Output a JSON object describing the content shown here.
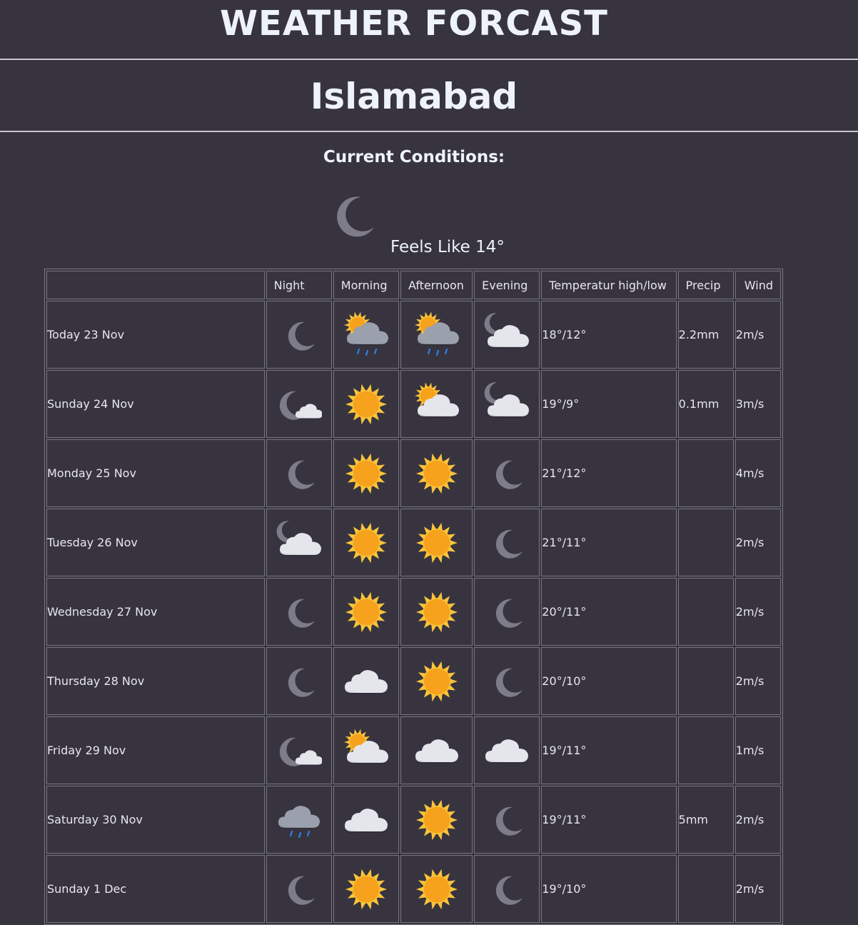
{
  "app": {
    "title": "WEATHER FORCAST"
  },
  "location": {
    "city": "Islamabad"
  },
  "current": {
    "heading": "Current Conditions:",
    "icon": "moon",
    "feels_like": "Feels Like 14°"
  },
  "table": {
    "headers": [
      "",
      "Night",
      "Morning",
      "Afternoon",
      "Evening",
      "Temperatur high/low",
      "Precip",
      "Wind"
    ],
    "rows": [
      {
        "day": "Today 23 Nov",
        "night": "moon",
        "morning": "sun-cloud-rain",
        "afternoon": "sun-cloud-rain",
        "evening": "moon-cloud",
        "temp": "18°/12°",
        "precip": "2.2mm",
        "wind": "2m/s"
      },
      {
        "day": "Sunday 24 Nov",
        "night": "moon-small-cloud",
        "morning": "sun",
        "afternoon": "sun-cloud",
        "evening": "moon-cloud",
        "temp": "19°/9°",
        "precip": "0.1mm",
        "wind": "3m/s"
      },
      {
        "day": "Monday 25 Nov",
        "night": "moon",
        "morning": "sun",
        "afternoon": "sun",
        "evening": "moon",
        "temp": "21°/12°",
        "precip": "",
        "wind": "4m/s"
      },
      {
        "day": "Tuesday 26 Nov",
        "night": "moon-cloud",
        "morning": "sun",
        "afternoon": "sun",
        "evening": "moon",
        "temp": "21°/11°",
        "precip": "",
        "wind": "2m/s"
      },
      {
        "day": "Wednesday 27 Nov",
        "night": "moon",
        "morning": "sun",
        "afternoon": "sun",
        "evening": "moon",
        "temp": "20°/11°",
        "precip": "",
        "wind": "2m/s"
      },
      {
        "day": "Thursday 28 Nov",
        "night": "moon",
        "morning": "cloud",
        "afternoon": "sun",
        "evening": "moon",
        "temp": "20°/10°",
        "precip": "",
        "wind": "2m/s"
      },
      {
        "day": "Friday 29 Nov",
        "night": "moon-small-cloud",
        "morning": "sun-cloud",
        "afternoon": "cloud",
        "evening": "cloud",
        "temp": "19°/11°",
        "precip": "",
        "wind": "1m/s"
      },
      {
        "day": "Saturday 30 Nov",
        "night": "rain-cloud",
        "morning": "cloud",
        "afternoon": "sun",
        "evening": "moon",
        "temp": "19°/11°",
        "precip": "5mm",
        "wind": "2m/s"
      },
      {
        "day": "Sunday 1 Dec",
        "night": "moon",
        "morning": "sun",
        "afternoon": "sun",
        "evening": "moon",
        "temp": "19°/10°",
        "precip": "",
        "wind": "2m/s"
      }
    ]
  },
  "colors": {
    "background": "#37343f",
    "title_text": "#eef3fb",
    "sun": "#f6a21c",
    "moon": "#7d7c88",
    "cloud": "#e4e6ec",
    "rain_cloud": "#9aa0ac",
    "rain": "#2f7fe0"
  }
}
